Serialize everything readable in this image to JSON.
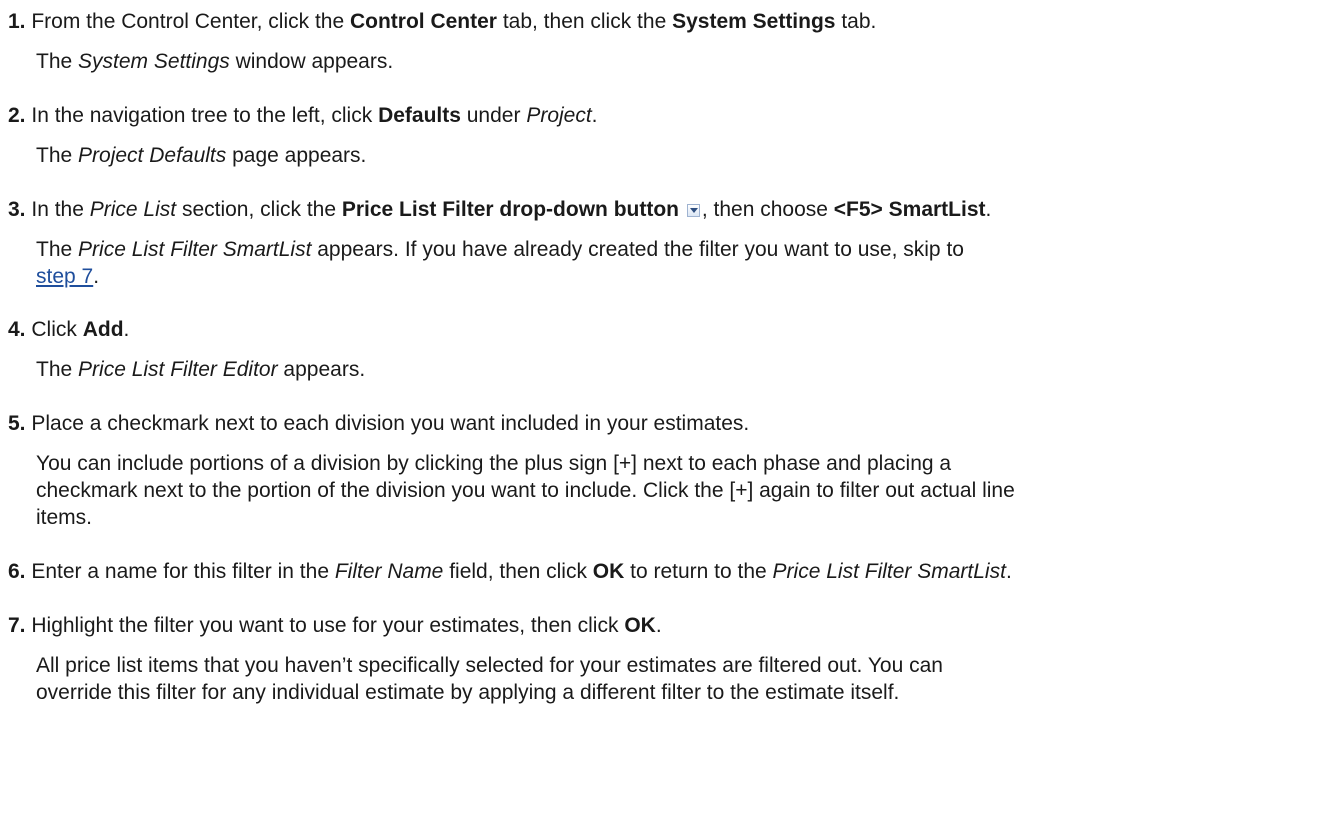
{
  "steps": [
    {
      "num": "1.",
      "t1": "From the Control Center, click the ",
      "b1": "Control Center",
      "t2": " tab, then click the ",
      "b2": "System Settings",
      "t3": " tab.",
      "desc_i1": "System Settings",
      "desc_t1": " window appears."
    },
    {
      "num": "2.",
      "t1": "In the navigation tree to the left, click ",
      "b1": "Defaults",
      "t2": " under ",
      "i1": "Project",
      "t3": ".",
      "desc_i1": "Project Defaults",
      "desc_t1": " page appears."
    },
    {
      "num": "3.",
      "t1": "In the ",
      "i1": "Price List",
      "t2": " section, click the ",
      "b1": "Price List Filter drop-down button",
      "t3": ", then choose ",
      "b2": "<F5> SmartList",
      "t4": ".",
      "desc_i1": "Price List Filter SmartList",
      "desc_t1": " appears. If you have already created the filter you want to use, skip to",
      "desc_link": "step 7",
      "desc_t2": "."
    },
    {
      "num": "4.",
      "t1": "Click ",
      "b1": "Add",
      "t2": ".",
      "desc_i1": "Price List Filter Editor",
      "desc_t1": " appears."
    },
    {
      "num": "5.",
      "t1": "Place a checkmark next to each division you want included in your estimates.",
      "desc_l1": "You can include portions of a division by clicking the plus sign [+] next to each phase and placing a",
      "desc_l2": "checkmark next to the portion of the division you want to include. Click the [+] again to filter out actual line",
      "desc_l3": "items."
    },
    {
      "num": "6.",
      "t1": "Enter a name for this filter in the ",
      "i1": "Filter Name",
      "t2": " field, then click ",
      "b1": "OK",
      "t3": " to return to the ",
      "i2": "Price List Filter SmartList",
      "t4": "."
    },
    {
      "num": "7.",
      "t1": "Highlight the filter you want to use for your estimates, then click ",
      "b1": "OK",
      "t2": ".",
      "desc_l1": "All price list items that you haven’t specifically selected for your estimates are filtered out. You can",
      "desc_l2": "override this filter for any individual estimate by applying a different filter to the estimate itself."
    }
  ],
  "the_word": "The",
  "icons": {
    "dropdown": "dropdown-button-icon"
  }
}
